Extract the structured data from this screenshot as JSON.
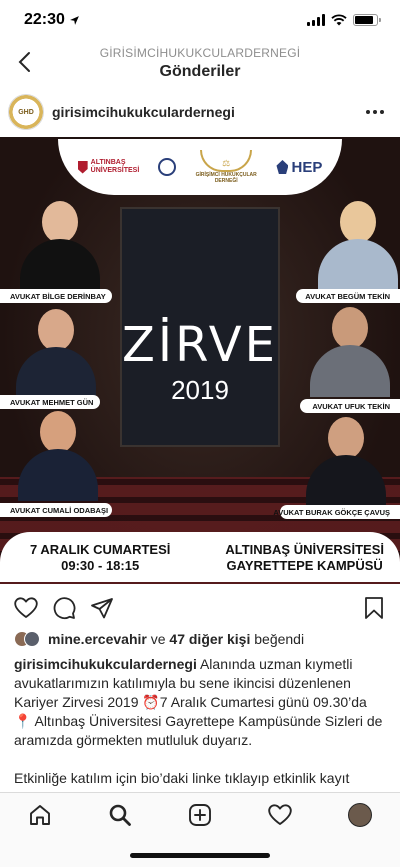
{
  "status_bar": {
    "time": "22:30",
    "battery_level": 0.85
  },
  "header": {
    "account": "GİRİSİMCİHUKUKCULARDERNEGİ",
    "title": "Gönderiler"
  },
  "post": {
    "username": "girisimcihukukculardernegi",
    "avatar_text": "GHD",
    "image": {
      "logos": {
        "altinbas": "ALTINBAŞ ÜNİVERSİTESİ",
        "center": "GİRİŞİMCİ HUKUKÇULAR DERNEĞİ",
        "hep": "HEP"
      },
      "event_title": "ZİRVE",
      "event_year": "2019",
      "speakers": [
        "AVUKAT BİLGE DERİNBAY",
        "AVUKAT BEGÜM TEKİN",
        "AVUKAT MEHMET GÜN",
        "AVUKAT UFUK TEKİN",
        "AVUKAT CUMALİ ODABAŞI",
        "AVUKAT BURAK GÖKÇE ÇAVUŞ"
      ],
      "date_line": "7 ARALIK CUMARTESİ",
      "time_line": "09:30 - 18:15",
      "venue_line1": "ALTINBAŞ ÜNİVERSİTESİ",
      "venue_line2": "GAYRETTEPE KAMPÜSÜ"
    },
    "likes": {
      "liker": "mine.ercevahir",
      "connector": "ve",
      "others": "47 diğer kişi",
      "suffix": "beğendi"
    },
    "caption": {
      "username": "girisimcihukukculardernegi",
      "text1": "Alanında uzman kıymetli avukatlarımızın katılımıyla bu sene ikincisi düzenlenen Kariyer Zirvesi 2019 ⏰7 Aralık Cumartesi günü 09.30’da 📍 Altınbaş Üniversitesi Gayrettepe Kampüsünde Sizleri de aramızda görmekten mutluluk duyarız.",
      "text2": "Etkinliğe katılım için bio’daki linke tıklayıp etkinlik kayıt formunu doldurmanız gerekmektedir."
    }
  },
  "colors": {
    "brand_gold": "#c9a54a",
    "dark_bg": "#1f1210",
    "text": "#262626",
    "muted": "#8e8e8e"
  }
}
